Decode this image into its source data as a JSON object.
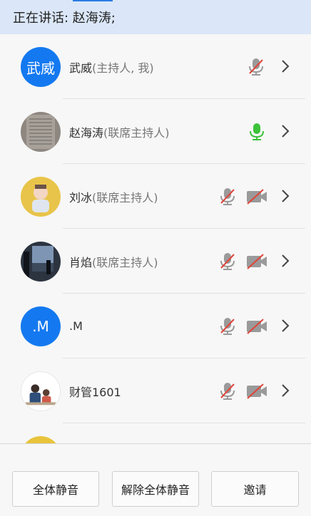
{
  "speaking": {
    "text": "正在讲话: 赵海涛;"
  },
  "participants": [
    {
      "name": "武威",
      "role": "(主持人, 我)",
      "avatar": "letter",
      "avatar_text": "武威",
      "mic": "muted",
      "camera": "none"
    },
    {
      "name": "赵海涛",
      "role": "(联席主持人)",
      "avatar": "photo-document",
      "mic": "active",
      "camera": "none"
    },
    {
      "name": "刘冰",
      "role": "(联席主持人)",
      "avatar": "photo-child",
      "mic": "muted",
      "camera": "off"
    },
    {
      "name": "肖焰",
      "role": "(联席主持人)",
      "avatar": "photo-window",
      "mic": "muted",
      "camera": "off"
    },
    {
      "name": ".M",
      "role": "",
      "avatar": "letter",
      "avatar_text": ".M",
      "mic": "muted",
      "camera": "off"
    },
    {
      "name": "财管1601",
      "role": "",
      "avatar": "photo-people",
      "mic": "muted",
      "camera": "off"
    },
    {
      "name": "",
      "role": "",
      "avatar": "photo-yellow",
      "mic": "",
      "camera": ""
    }
  ],
  "buttons": {
    "mute_all": "全体静音",
    "unmute_all": "解除全体静音",
    "invite": "邀请"
  },
  "colors": {
    "accent": "#1479f0",
    "speaking_bg": "#dbe7f8",
    "mic_active": "#3cc23c",
    "muted_red": "#e0453a"
  }
}
